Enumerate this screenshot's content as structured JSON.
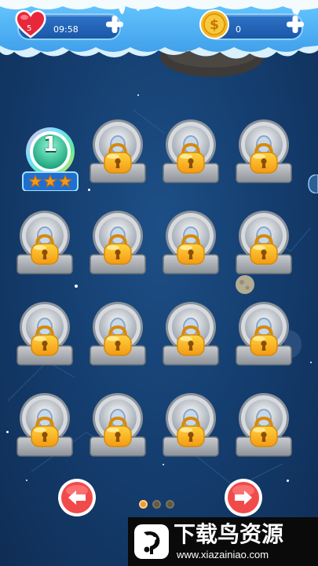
{
  "hud": {
    "lives": "5",
    "timer": "09:58",
    "coins": "0",
    "left_icon": "heart-icon",
    "right_icon": "dollar-coin-icon",
    "add_icon": "plus-icon"
  },
  "levels": [
    {
      "label": "1",
      "state": "unlocked",
      "stars": 3
    },
    {
      "state": "locked"
    },
    {
      "state": "locked"
    },
    {
      "state": "locked"
    },
    {
      "state": "locked"
    },
    {
      "state": "locked"
    },
    {
      "state": "locked"
    },
    {
      "state": "locked"
    },
    {
      "state": "locked"
    },
    {
      "state": "locked"
    },
    {
      "state": "locked"
    },
    {
      "state": "locked"
    },
    {
      "state": "locked"
    },
    {
      "state": "locked"
    },
    {
      "state": "locked"
    },
    {
      "state": "locked"
    }
  ],
  "pager": {
    "prev_icon": "left-arrow-icon",
    "next_icon": "right-arrow-icon",
    "page_count": 3,
    "current_page": 1
  },
  "watermark": {
    "title": "下载鸟资源",
    "url": "www.xiazainiao.com"
  },
  "colors": {
    "background": "#153f71",
    "heart": "#e8283a",
    "coin": "#f4b71e",
    "nav_button": "#f24a4a",
    "page_dot_active": "#f29a2e",
    "badge_ring": "#52e0b8",
    "star": "#f39a1e"
  }
}
